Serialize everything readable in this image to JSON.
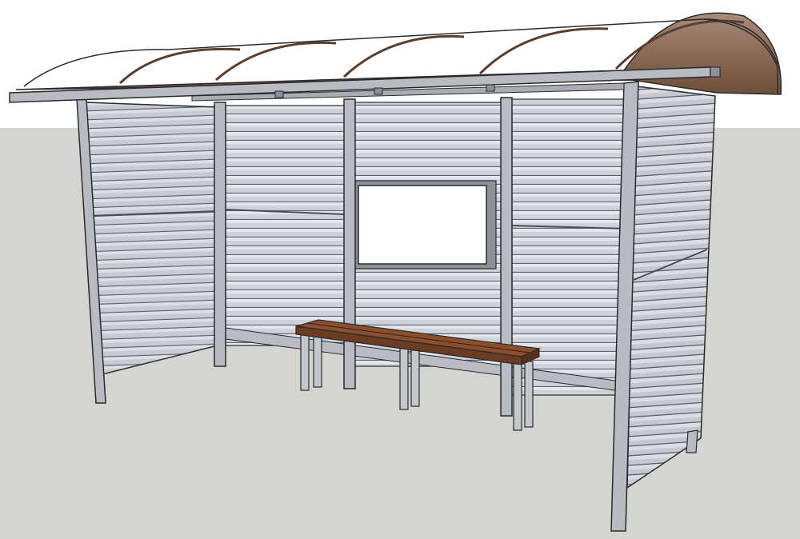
{
  "scene": {
    "subject": "bus-shelter-3d-model",
    "colors": {
      "sky": "#ffffff",
      "ground": "#d4d4d1",
      "panel": "#c9cdd3",
      "panel_light": "#dde0e5",
      "slat_line": "#6f747c",
      "frame": "#b8bcc2",
      "frame_dark": "#8c9097",
      "outline": "#2a2a2a",
      "roof": "#8a6a55",
      "roof_dark": "#6e4f3c",
      "roof_light": "#a8897a",
      "bench_wood": "#6b3b22",
      "bench_wood_light": "#8a4f2e",
      "bench_leg": "#c4c7cc",
      "notice_board": "#ffffff"
    }
  }
}
